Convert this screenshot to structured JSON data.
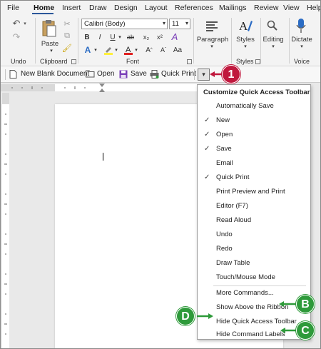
{
  "tabs": [
    "File",
    "Home",
    "Insert",
    "Draw",
    "Design",
    "Layout",
    "References",
    "Mailings",
    "Review",
    "View",
    "Help"
  ],
  "ribbon": {
    "groups": {
      "undo": "Undo",
      "clipboard": "Clipboard",
      "font": "Font",
      "styles": "Styles",
      "voice": "Voice"
    },
    "paste_label": "Paste",
    "font_name": "Calibri (Body)",
    "font_size": "11",
    "bold": "B",
    "italic": "I",
    "underline": "U",
    "strikethrough": "ab",
    "subscript": "x₂",
    "superscript": "x²",
    "paragraph_label": "Paragraph",
    "styles_label": "Styles",
    "editing_label": "Editing",
    "dictate_label": "Dictate"
  },
  "qat": {
    "new_blank": "New Blank Document",
    "open": "Open",
    "save": "Save",
    "quick_print": "Quick Print"
  },
  "menu": {
    "title": "Customize Quick Access Toolbar",
    "items": [
      {
        "label": "Automatically Save",
        "checked": false
      },
      {
        "label": "New",
        "checked": true
      },
      {
        "label": "Open",
        "checked": true
      },
      {
        "label": "Save",
        "checked": true
      },
      {
        "label": "Email",
        "checked": false
      },
      {
        "label": "Quick Print",
        "checked": true
      },
      {
        "label": "Print Preview and Print",
        "checked": false
      },
      {
        "label": "Editor (F7)",
        "checked": false
      },
      {
        "label": "Read Aloud",
        "checked": false
      },
      {
        "label": "Undo",
        "checked": false
      },
      {
        "label": "Redo",
        "checked": false
      },
      {
        "label": "Draw Table",
        "checked": false
      },
      {
        "label": "Touch/Mouse Mode",
        "checked": false
      }
    ],
    "more_commands": "More Commands...",
    "show_above": "Show Above the Ribbon",
    "hide_qat": "Hide Quick Access Toolbar",
    "hide_labels": "Hide Command Labels"
  },
  "callouts": {
    "one": "1",
    "b": "B",
    "c": "C",
    "d": "D"
  },
  "colors": {
    "accent": "#2b579a",
    "callout_green": "#2e9a3a",
    "callout_red": "#c0183d"
  }
}
